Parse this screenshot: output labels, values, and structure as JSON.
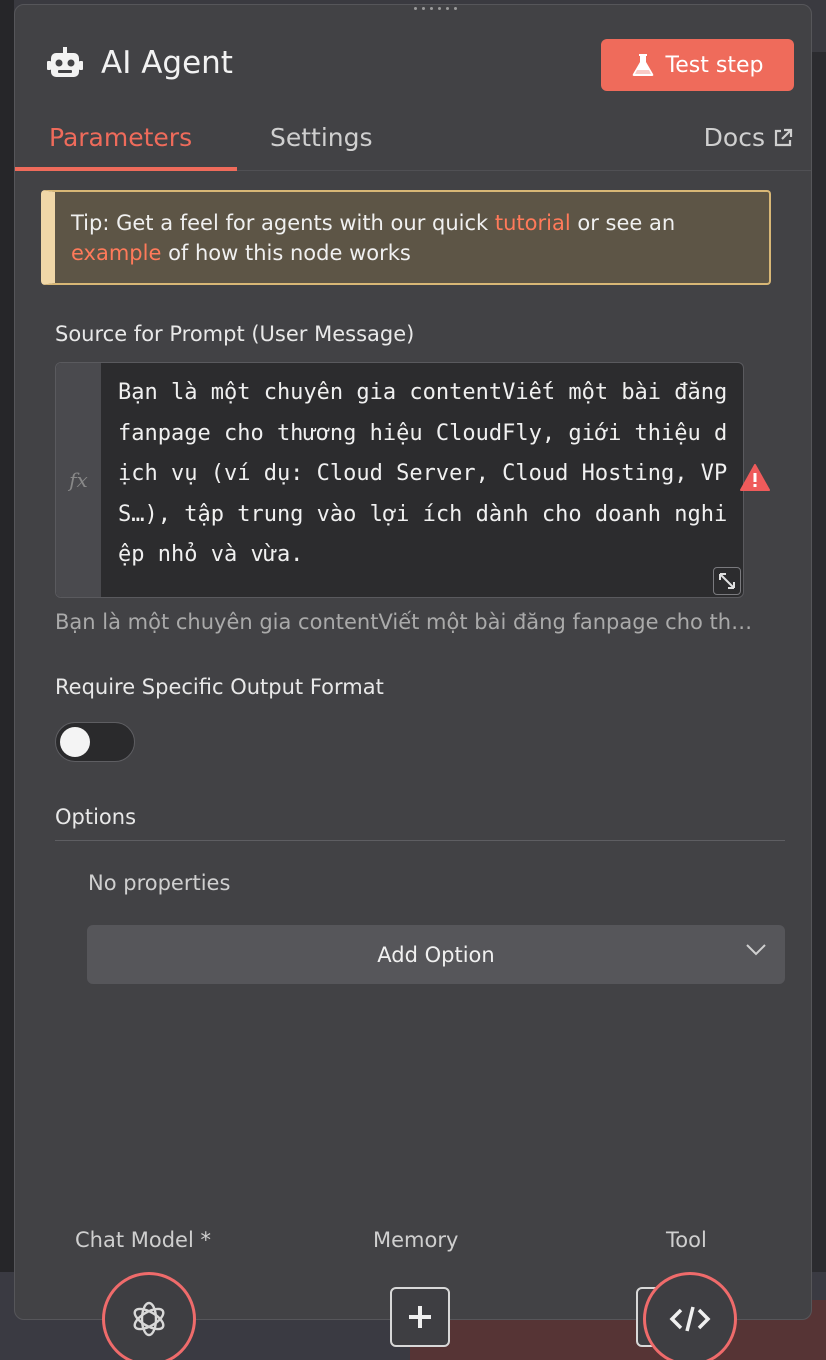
{
  "header": {
    "title": "AI Agent",
    "test_step_label": "Test step",
    "accent_color": "#ef6b5b"
  },
  "tabs": [
    {
      "label": "Parameters",
      "active": true
    },
    {
      "label": "Settings",
      "active": false
    }
  ],
  "docs_label": "Docs",
  "tip": {
    "prefix": "Tip: Get a feel for agents with our quick ",
    "link1": "tutorial",
    "middle": " or see an ",
    "link2": "example",
    "suffix": " of how this node works"
  },
  "prompt": {
    "label": "Source for Prompt (User Message)",
    "value": "Bạn là một chuyên gia contentViết một bài đăng fanpage cho thương hiệu CloudFly, giới thiệu dịch vụ (ví dụ: Cloud Server, Cloud Hosting, VPS…), tập trung vào lợi ích dành cho doanh nghiệp nhỏ và vừa.",
    "preview": "Bạn là một chuyên gia contentViết một bài đăng fanpage cho th…",
    "fx_label": "fx"
  },
  "output_format": {
    "label": "Require Specific Output Format",
    "enabled": false
  },
  "options": {
    "label": "Options",
    "empty_text": "No properties",
    "add_label": "Add Option"
  },
  "connections": {
    "chat_model_label": "Chat Model *",
    "memory_label": "Memory",
    "tool_label": "Tool"
  },
  "icons": {
    "robot": "robot-icon",
    "flask": "flask-icon",
    "external": "external-link-icon",
    "warning": "warning-icon",
    "openai": "openai-icon",
    "plus": "plus-icon",
    "code": "code-icon"
  }
}
